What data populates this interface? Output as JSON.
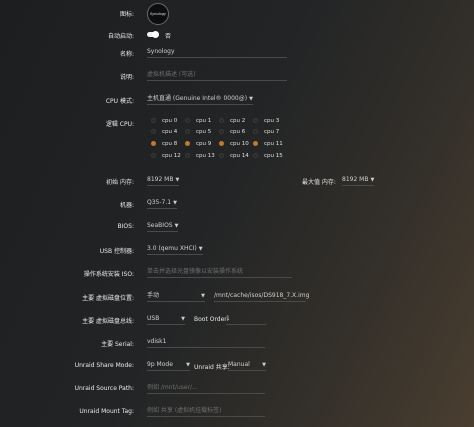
{
  "icon": {
    "label": "图标:",
    "logo_text": "Synology"
  },
  "autostart": {
    "label": "自动启动:",
    "value": "否"
  },
  "name": {
    "label": "名称:",
    "value": "Synology"
  },
  "description": {
    "label": "说明:",
    "placeholder": "虚拟机描述 (可选)"
  },
  "cpu_mode": {
    "label": "CPU 模式:",
    "value": "主机直通 (Genuine Intel® 0000@)"
  },
  "logical_cpu": {
    "label": "逻辑 CPU:",
    "cpus": [
      {
        "label": "cpu 0",
        "selected": false
      },
      {
        "label": "cpu 1",
        "selected": false
      },
      {
        "label": "cpu 2",
        "selected": false
      },
      {
        "label": "cpu 3",
        "selected": false
      },
      {
        "label": "cpu 4",
        "selected": false
      },
      {
        "label": "cpu 5",
        "selected": false
      },
      {
        "label": "cpu 6",
        "selected": false
      },
      {
        "label": "cpu 7",
        "selected": false
      },
      {
        "label": "cpu 8",
        "selected": true
      },
      {
        "label": "cpu 9",
        "selected": true
      },
      {
        "label": "cpu 10",
        "selected": true
      },
      {
        "label": "cpu 11",
        "selected": true
      },
      {
        "label": "cpu 12",
        "selected": false
      },
      {
        "label": "cpu 13",
        "selected": false
      },
      {
        "label": "cpu 14",
        "selected": false
      },
      {
        "label": "cpu 15",
        "selected": false
      }
    ],
    "on_color": "#c07a2c"
  },
  "memory": {
    "label": "初始 内存:",
    "value": "8192 MB",
    "max_label": "最大值 内存:",
    "max_value": "8192 MB"
  },
  "machine": {
    "label": "机器:",
    "value": "Q35-7.1"
  },
  "bios": {
    "label": "BIOS:",
    "value": "SeaBIOS"
  },
  "usb": {
    "label": "USB 控制器:",
    "value": "3.0 (qemu XHCI)"
  },
  "os_iso": {
    "label": "操作系统安装 ISO:",
    "placeholder": "单击并选择光盘镜像以安装操作系统"
  },
  "vdisk_location": {
    "label": "主要 虚拟磁盘位置:",
    "mode": "手动",
    "path": "/mnt/cache/isos/DS918_7.X.img"
  },
  "vdisk_bus": {
    "label": "主要 虚拟磁盘总线:",
    "value": "USB",
    "boot_order_label": "Boot Order:",
    "boot_order_value": "1"
  },
  "serial": {
    "label": "主要 Serial:",
    "value": "vdisk1"
  },
  "share_mode": {
    "label": "Unraid Share Mode:",
    "value": "9p Mode",
    "share_label": "Unraid 共享:",
    "share_value": "Manual"
  },
  "source_path": {
    "label": "Unraid Source Path:",
    "placeholder": "例如 /mnt/user/..."
  },
  "mount_tag": {
    "label": "Unraid Mount Tag:",
    "placeholder": "例如 共享 (虚拟机挂载标签)"
  }
}
